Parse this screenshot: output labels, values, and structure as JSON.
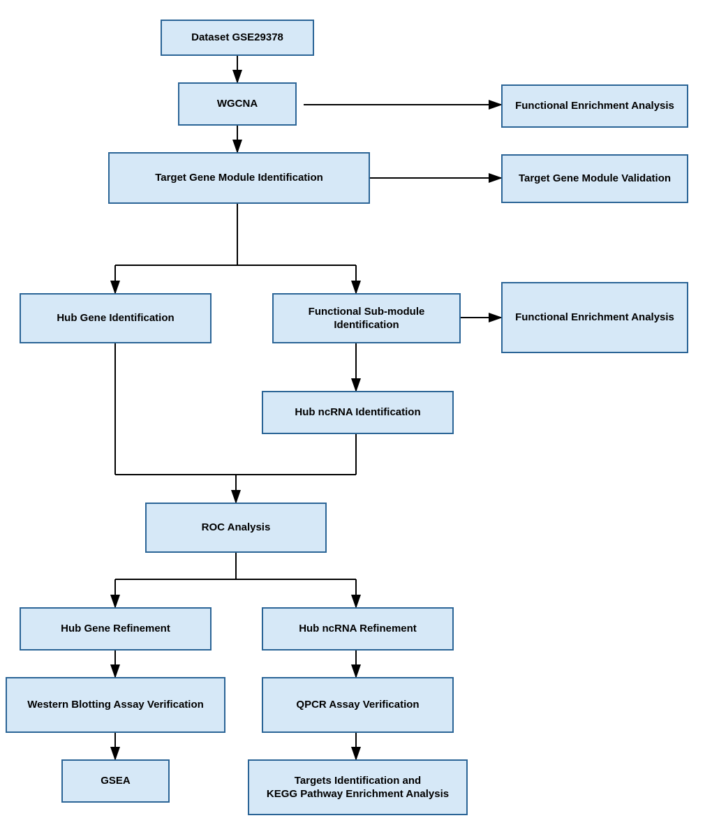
{
  "boxes": {
    "dataset": {
      "label": "Dataset GSE29378"
    },
    "wgcna": {
      "label": "WGCNA"
    },
    "functional_enrichment_1": {
      "label": "Functional Enrichment Analysis"
    },
    "target_gene_module": {
      "label": "Target Gene Module Identification"
    },
    "target_gene_validation": {
      "label": "Target Gene Module Validation"
    },
    "hub_gene_id": {
      "label": "Hub Gene Identification"
    },
    "functional_submodule": {
      "label": "Functional Sub-module\nIdentification"
    },
    "functional_enrichment_2": {
      "label": "Functional Enrichment Analysis"
    },
    "hub_ncrna_id": {
      "label": "Hub ncRNA Identification"
    },
    "roc_analysis": {
      "label": "ROC Analysis"
    },
    "hub_gene_refinement": {
      "label": "Hub Gene Refinement"
    },
    "hub_ncrna_refinement": {
      "label": "Hub ncRNA Refinement"
    },
    "western_blotting": {
      "label": "Western Blotting Assay Verification"
    },
    "qpcr": {
      "label": "QPCR Assay Verification"
    },
    "gsea": {
      "label": "GSEA"
    },
    "targets_kegg": {
      "label": "Targets Identification and\nKEGG Pathway Enrichment Analysis"
    }
  }
}
